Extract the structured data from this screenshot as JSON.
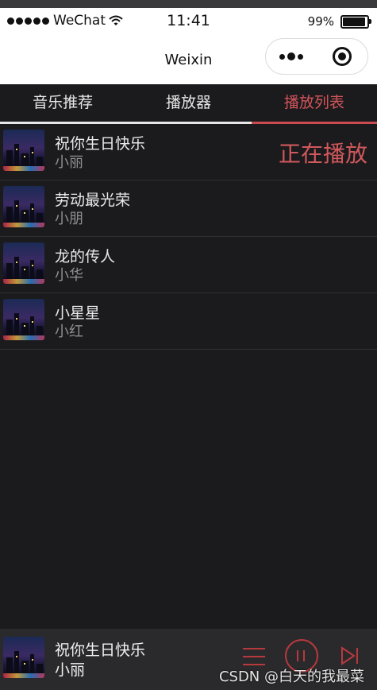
{
  "status_bar": {
    "carrier": "WeChat",
    "time": "11:41",
    "battery": "99%"
  },
  "nav_bar": {
    "title": "Weixin"
  },
  "tabs": [
    {
      "label": "音乐推荐",
      "active": false
    },
    {
      "label": "播放器",
      "active": false
    },
    {
      "label": "播放列表",
      "active": true
    }
  ],
  "playlist": {
    "now_playing_label": "正在播放",
    "songs": [
      {
        "title": "祝你生日快乐",
        "artist": "小丽"
      },
      {
        "title": "劳动最光荣",
        "artist": "小朋"
      },
      {
        "title": "龙的传人",
        "artist": "小华"
      },
      {
        "title": "小星星",
        "artist": "小红"
      }
    ]
  },
  "mini_player": {
    "title": "祝你生日快乐",
    "artist": "小丽",
    "watermark": "CSDN @白天的我最菜"
  },
  "colors": {
    "accent": "#d2545a",
    "background": "#1b1b1d",
    "mini_player_bg": "#2a2a2c"
  },
  "icons": {
    "wifi": "wifi-icon",
    "battery": "battery-icon",
    "more": "more-icon",
    "close": "close-icon",
    "list": "list-icon",
    "pause": "pause-icon",
    "next": "next-track-icon"
  }
}
